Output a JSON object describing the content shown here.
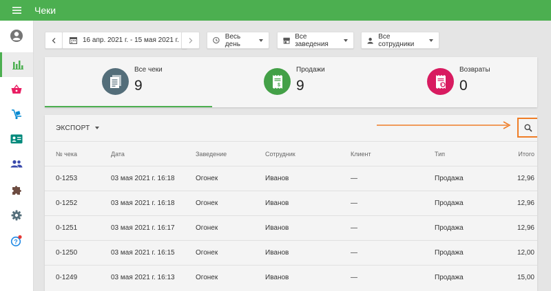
{
  "app": {
    "title": "Чеки",
    "accent": "#4caf50",
    "highlight": "#ef7d26"
  },
  "sidebar": {
    "items": [
      {
        "name": "account-icon",
        "active": false
      },
      {
        "name": "reports-icon",
        "active": true
      },
      {
        "name": "basket-icon",
        "active": false
      },
      {
        "name": "inventory-icon",
        "active": false
      },
      {
        "name": "employee-card-icon",
        "active": false
      },
      {
        "name": "customers-icon",
        "active": false
      },
      {
        "name": "integrations-icon",
        "active": false
      },
      {
        "name": "settings-icon",
        "active": false
      },
      {
        "name": "help-icon",
        "active": false
      }
    ]
  },
  "filters": {
    "date_range": "16 апр. 2021 г. - 15 мая 2021 г.",
    "time": "Весь день",
    "stores": "Все заведения",
    "employees": "Все сотрудники"
  },
  "summary": {
    "all": {
      "label": "Все чеки",
      "value": "9",
      "color": "#546e7a"
    },
    "sales": {
      "label": "Продажи",
      "value": "9",
      "color": "#43a047"
    },
    "refunds": {
      "label": "Возвраты",
      "value": "0",
      "color": "#d81b60"
    }
  },
  "toolbar": {
    "export_label": "ЭКСПОРТ"
  },
  "table": {
    "headers": [
      "№ чека",
      "Дата",
      "Заведение",
      "Сотрудник",
      "Клиент",
      "Тип",
      "Итого"
    ],
    "rows": [
      [
        "0-1253",
        "03 мая 2021 г. 16:18",
        "Огонек",
        "Иванов",
        "—",
        "Продажа",
        "12,96"
      ],
      [
        "0-1252",
        "03 мая 2021 г. 16:18",
        "Огонек",
        "Иванов",
        "—",
        "Продажа",
        "12,96"
      ],
      [
        "0-1251",
        "03 мая 2021 г. 16:17",
        "Огонек",
        "Иванов",
        "—",
        "Продажа",
        "12,96"
      ],
      [
        "0-1250",
        "03 мая 2021 г. 16:15",
        "Огонек",
        "Иванов",
        "—",
        "Продажа",
        "12,00"
      ],
      [
        "0-1249",
        "03 мая 2021 г. 16:13",
        "Огонек",
        "Иванов",
        "—",
        "Продажа",
        "15,00"
      ]
    ]
  }
}
